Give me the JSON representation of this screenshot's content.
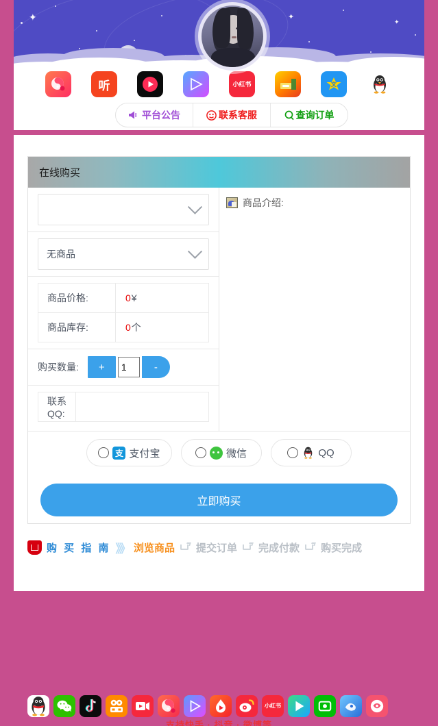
{
  "theme": {
    "frame_pink": "#c74e8e",
    "sky_purple": "#4f4bc4",
    "accent_blue": "#3ba1ea",
    "price_red": "#e60000",
    "active_orange": "#f7901e"
  },
  "banner": {
    "avatar_alt": "user-avatar",
    "apps": [
      {
        "name": "qq-music-icon",
        "label": "",
        "bg": "linear-gradient(135deg,#ff7a4d,#ff2e63)"
      },
      {
        "name": "ting-icon",
        "label": "听",
        "bg": "#f5441f"
      },
      {
        "name": "douyin-live-icon",
        "label": "",
        "bg": "#0b0b0b"
      },
      {
        "name": "xigua-icon",
        "label": "",
        "bg": "linear-gradient(135deg,#56a8ff,#d44bff)"
      },
      {
        "name": "xiaohongshu-icon",
        "label": "小红书",
        "bg": "#f5283c"
      },
      {
        "name": "game-icon",
        "label": "",
        "bg": "linear-gradient(140deg,#ffd000,#ff5a00)"
      },
      {
        "name": "qq-star-icon",
        "label": "",
        "bg": "#2196f3"
      },
      {
        "name": "qq-penguin-icon",
        "label": "",
        "bg": "#ffffff"
      }
    ],
    "nav": [
      {
        "name": "platform-notice",
        "label": "平台公告",
        "icon": "megaphone-icon",
        "color": "#a04ed6"
      },
      {
        "name": "contact-support",
        "label": "联系客服",
        "icon": "support-face-icon",
        "color": "#ef1c1c"
      },
      {
        "name": "query-order",
        "label": "查询订单",
        "icon": "search-q-icon",
        "color": "#12a012"
      }
    ]
  },
  "card": {
    "title": "在线购买",
    "category_select": {
      "value": "",
      "placeholder": ""
    },
    "product_select": {
      "value": "无商品"
    },
    "rows": [
      {
        "key": "商品价格:",
        "num": "0",
        "unit": "¥"
      },
      {
        "key": "商品库存:",
        "num": "0",
        "unit": "个"
      }
    ],
    "quantity": {
      "label": "购买数量:",
      "plus": "+",
      "minus": "-",
      "value": "1"
    },
    "qq": {
      "label": "联系QQ:",
      "value": "",
      "placeholder": ""
    },
    "intro": {
      "icon": "image-icon",
      "label": "商品介绍:"
    },
    "payments": [
      {
        "name": "alipay",
        "label": "支付宝",
        "icon": "alipay-icon",
        "glyph": "支",
        "checked": false
      },
      {
        "name": "wechat",
        "label": "微信",
        "icon": "wechat-icon",
        "glyph": "",
        "checked": false
      },
      {
        "name": "qq",
        "label": "QQ",
        "icon": "qq-icon",
        "glyph": "",
        "checked": false
      }
    ],
    "buy_button": "立即购买"
  },
  "steps": {
    "guide": "购 买 指 南",
    "arrows": "》",
    "items": [
      {
        "label": "浏览商品",
        "active": true
      },
      {
        "label": "提交订单",
        "active": false
      },
      {
        "label": "完成付款",
        "active": false
      },
      {
        "label": "购买完成",
        "active": false
      }
    ]
  },
  "footer": {
    "apps": [
      {
        "name": "qq-icon",
        "bg": "#ffffff"
      },
      {
        "name": "wechat-icon",
        "bg": "#2dc100"
      },
      {
        "name": "douyin-icon",
        "bg": "#0b0b0b"
      },
      {
        "name": "kuaishou-icon",
        "bg": "#ff8a00"
      },
      {
        "name": "video-icon",
        "bg": "#f5283c"
      },
      {
        "name": "qq-music-icon",
        "bg": "linear-gradient(135deg,#ff6b4d,#f52d4d)"
      },
      {
        "name": "xigua-video-icon",
        "bg": "linear-gradient(135deg,#5a9bff,#e04bff)"
      },
      {
        "name": "huoshan-icon",
        "bg": "linear-gradient(135deg,#ff6a2b,#f5242b)"
      },
      {
        "name": "weibo-icon",
        "bg": "#f5283c"
      },
      {
        "name": "xiaohongshu-icon",
        "bg": "#f5283c"
      },
      {
        "name": "tencent-video-icon",
        "bg": "linear-gradient(135deg,#3ddc84,#1aa7ff)"
      },
      {
        "name": "iqiyi-icon",
        "bg": "#00be06"
      },
      {
        "name": "mango-tv-icon",
        "bg": "linear-gradient(135deg,#6fc7ff,#2a6ed8)"
      },
      {
        "name": "bilibili-icon",
        "bg": "#f5536f"
      }
    ],
    "tagline": "支持快手 · 抖音 · 微博等"
  }
}
